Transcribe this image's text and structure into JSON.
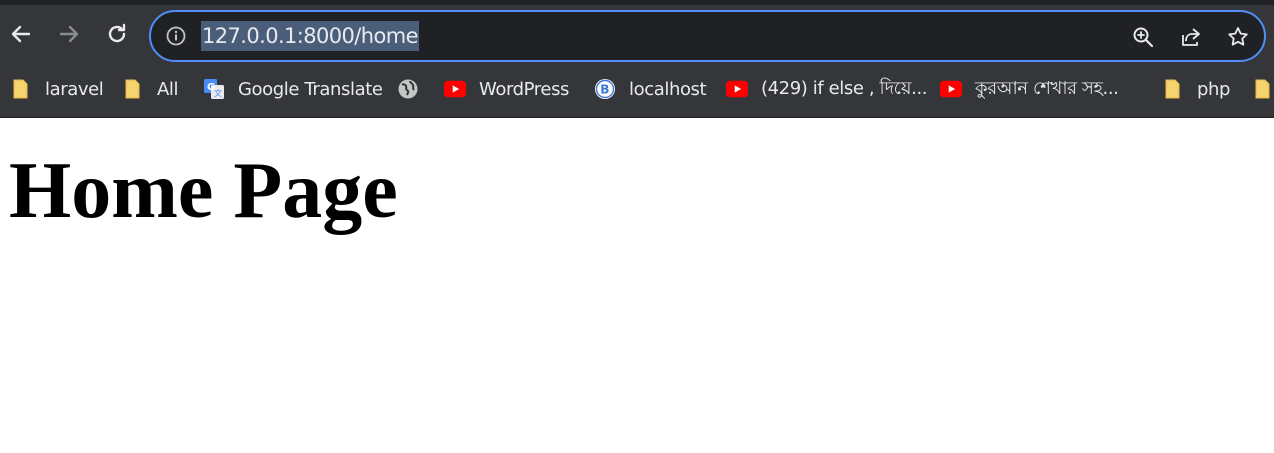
{
  "browser": {
    "url": "127.0.0.1:8000/home",
    "accent_color": "#4f8ef7",
    "frame_color": "#35363a",
    "nav": {
      "back_icon": "arrow-left-icon",
      "forward_icon": "arrow-right-icon",
      "reload_icon": "reload-icon"
    },
    "omnibox_icons": [
      "info-icon",
      "zoom-icon",
      "share-icon",
      "star-icon"
    ]
  },
  "bookmarks": [
    {
      "label": "laravel",
      "icon": "folder-icon"
    },
    {
      "label": "All",
      "icon": "folder-icon"
    },
    {
      "label": "Google Translate",
      "icon": "google-translate-icon"
    },
    {
      "label": "",
      "icon": "globe-icon"
    },
    {
      "label": "WordPress",
      "icon": "youtube-icon"
    },
    {
      "label": "localhost",
      "icon": "b-circle-icon"
    },
    {
      "label": "(429) if else , দিয়ে...",
      "icon": "youtube-icon"
    },
    {
      "label": "কুরআন শেখার সহ...",
      "icon": "youtube-icon"
    },
    {
      "label": "php",
      "icon": "folder-icon"
    },
    {
      "label": "",
      "icon": "folder-icon"
    }
  ],
  "page": {
    "heading": "Home Page"
  }
}
